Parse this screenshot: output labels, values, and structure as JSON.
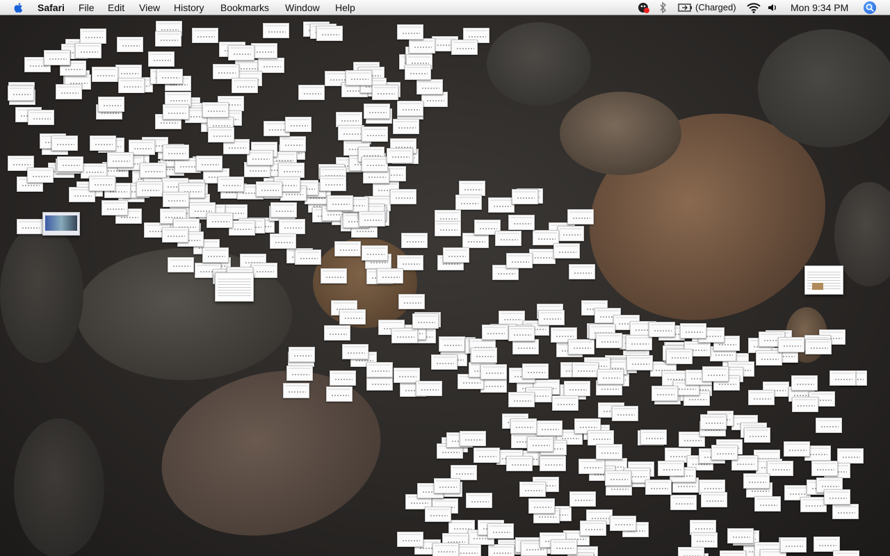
{
  "menubar": {
    "app_name": "Safari",
    "menus": [
      "File",
      "Edit",
      "View",
      "History",
      "Bookmarks",
      "Window",
      "Help"
    ],
    "battery_status": "(Charged)",
    "clock": "Mon 9:34 PM",
    "icons": [
      "apple-icon",
      "app-status-icon",
      "bluetooth-icon",
      "battery-icon",
      "wifi-icon",
      "volume-icon",
      "spotlight-icon"
    ]
  },
  "desktop": {
    "wallpaper": "dark pebbles",
    "thumbnails": {
      "count": 500,
      "kind": "exposé window thumbnails"
    }
  }
}
